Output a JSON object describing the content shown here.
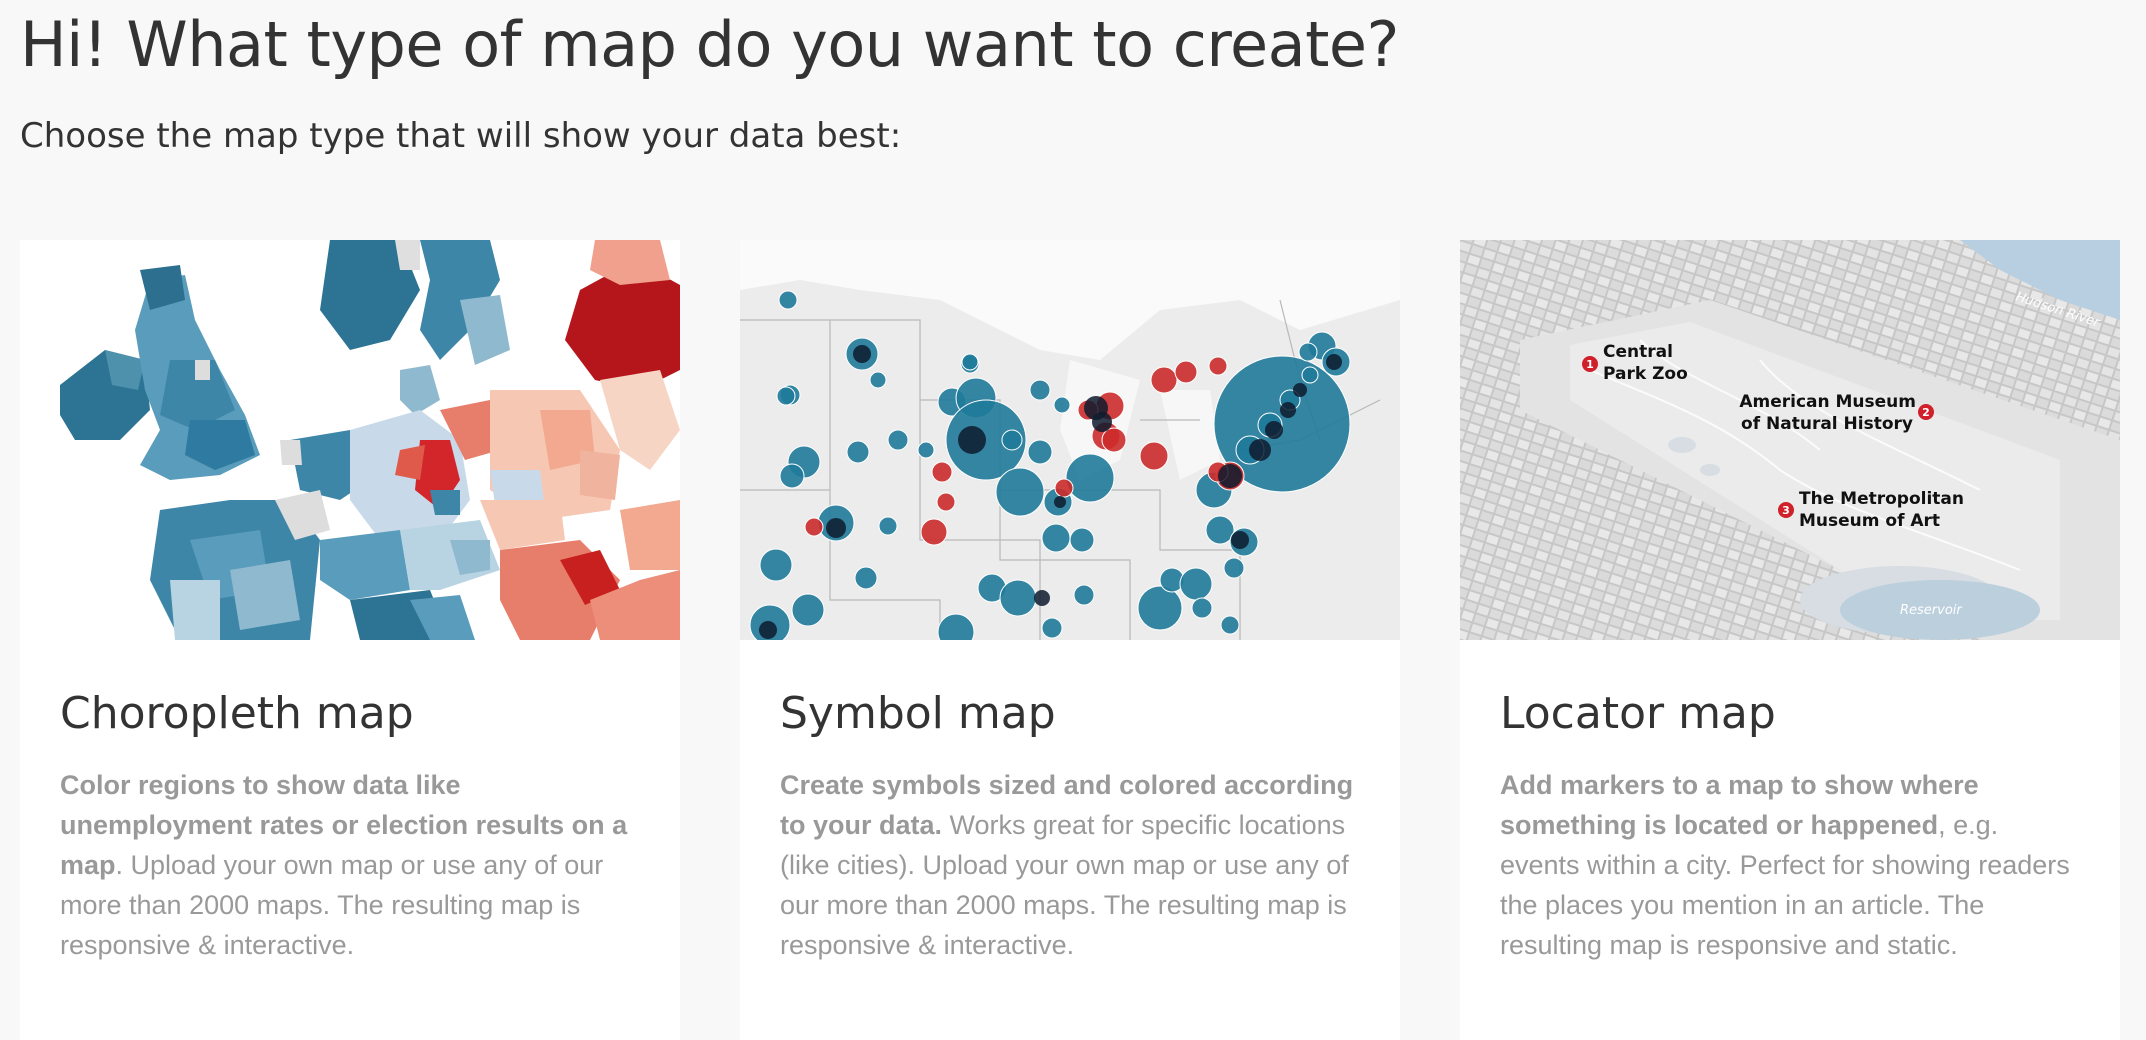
{
  "header": {
    "title": "Hi! What type of map do you want to create?",
    "subtitle": "Choose the map type that will show your data best:"
  },
  "cards": [
    {
      "title": "Choropleth map",
      "desc_bold": "Color regions to show data like unemployment rates or election results on a map",
      "desc_rest": ". Upload your own map or use any of our more than 2000 maps. The resulting map is responsive & interactive."
    },
    {
      "title": "Symbol map",
      "desc_bold": "Create symbols sized and colored according to your data.",
      "desc_rest": " Works great for specific locations (like cities). Upload your own map or use any of our more than 2000 maps. The resulting map is responsive & interactive."
    },
    {
      "title": "Locator map",
      "desc_bold": "Add markers to a map to show where something is located or happened",
      "desc_rest": ", e.g. events within a city. Perfect for showing readers the places you mention in an article. The resulting map is responsive and static.",
      "markers": [
        {
          "number": "1",
          "label_line1": "Central",
          "label_line2": "Park Zoo"
        },
        {
          "number": "2",
          "label_line1": "American Museum",
          "label_line2": "of Natural History"
        },
        {
          "number": "3",
          "label_line1": "The Metropolitan",
          "label_line2": "Museum of Art"
        }
      ],
      "water_labels": {
        "river": "Hudson River",
        "reservoir": "Reservoir"
      }
    }
  ],
  "colors": {
    "background": "#f8f8f8",
    "card": "#ffffff",
    "blue_dark": "#1f6e8c",
    "blue_mid": "#5aa0c0",
    "blue_light": "#b8d4e3",
    "red_dark": "#b5161b",
    "red_mid": "#e2705f",
    "red_light": "#f6c7b3",
    "symbol_blue": "#1f7a9a",
    "symbol_red": "#cc2b2b",
    "marker_red": "#d0202a"
  }
}
